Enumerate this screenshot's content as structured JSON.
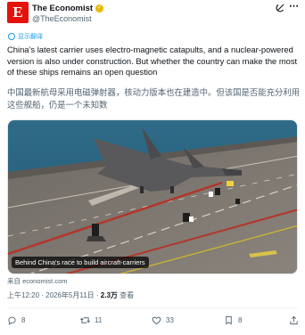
{
  "author": {
    "avatar_letter": "E",
    "display_name": "The Economist",
    "handle": "@TheEconomist"
  },
  "header_icons": [
    "grok-icon",
    "more-icon"
  ],
  "translate_label": "显示翻译",
  "tweet_text_en": "China’s latest carrier uses electro-magnetic catapults, and a nuclear-powered version is also under construction. But whether the country can make the most of these ships remains an open question",
  "tweet_text_zh": "中国最新航母采用电磁弹射器，核动力版本也在建造中。但该国是否能充分利用这些舰船，仍是一个未知数",
  "media": {
    "caption": "Behind China's race to build aircraft-carriers"
  },
  "source": "来自 economist.com",
  "meta": {
    "time": "上午12:20 · 2026年5月11日 · ",
    "views": "2.3万",
    "views_label": " 查看"
  },
  "actions": {
    "replies": "8",
    "reposts": "11",
    "likes": "33",
    "bookmarks": "8"
  },
  "colors": {
    "brand_red": "#e3120b",
    "verified_gold": "#e8b800",
    "link_blue": "#1d9bf0",
    "muted": "#536471"
  }
}
